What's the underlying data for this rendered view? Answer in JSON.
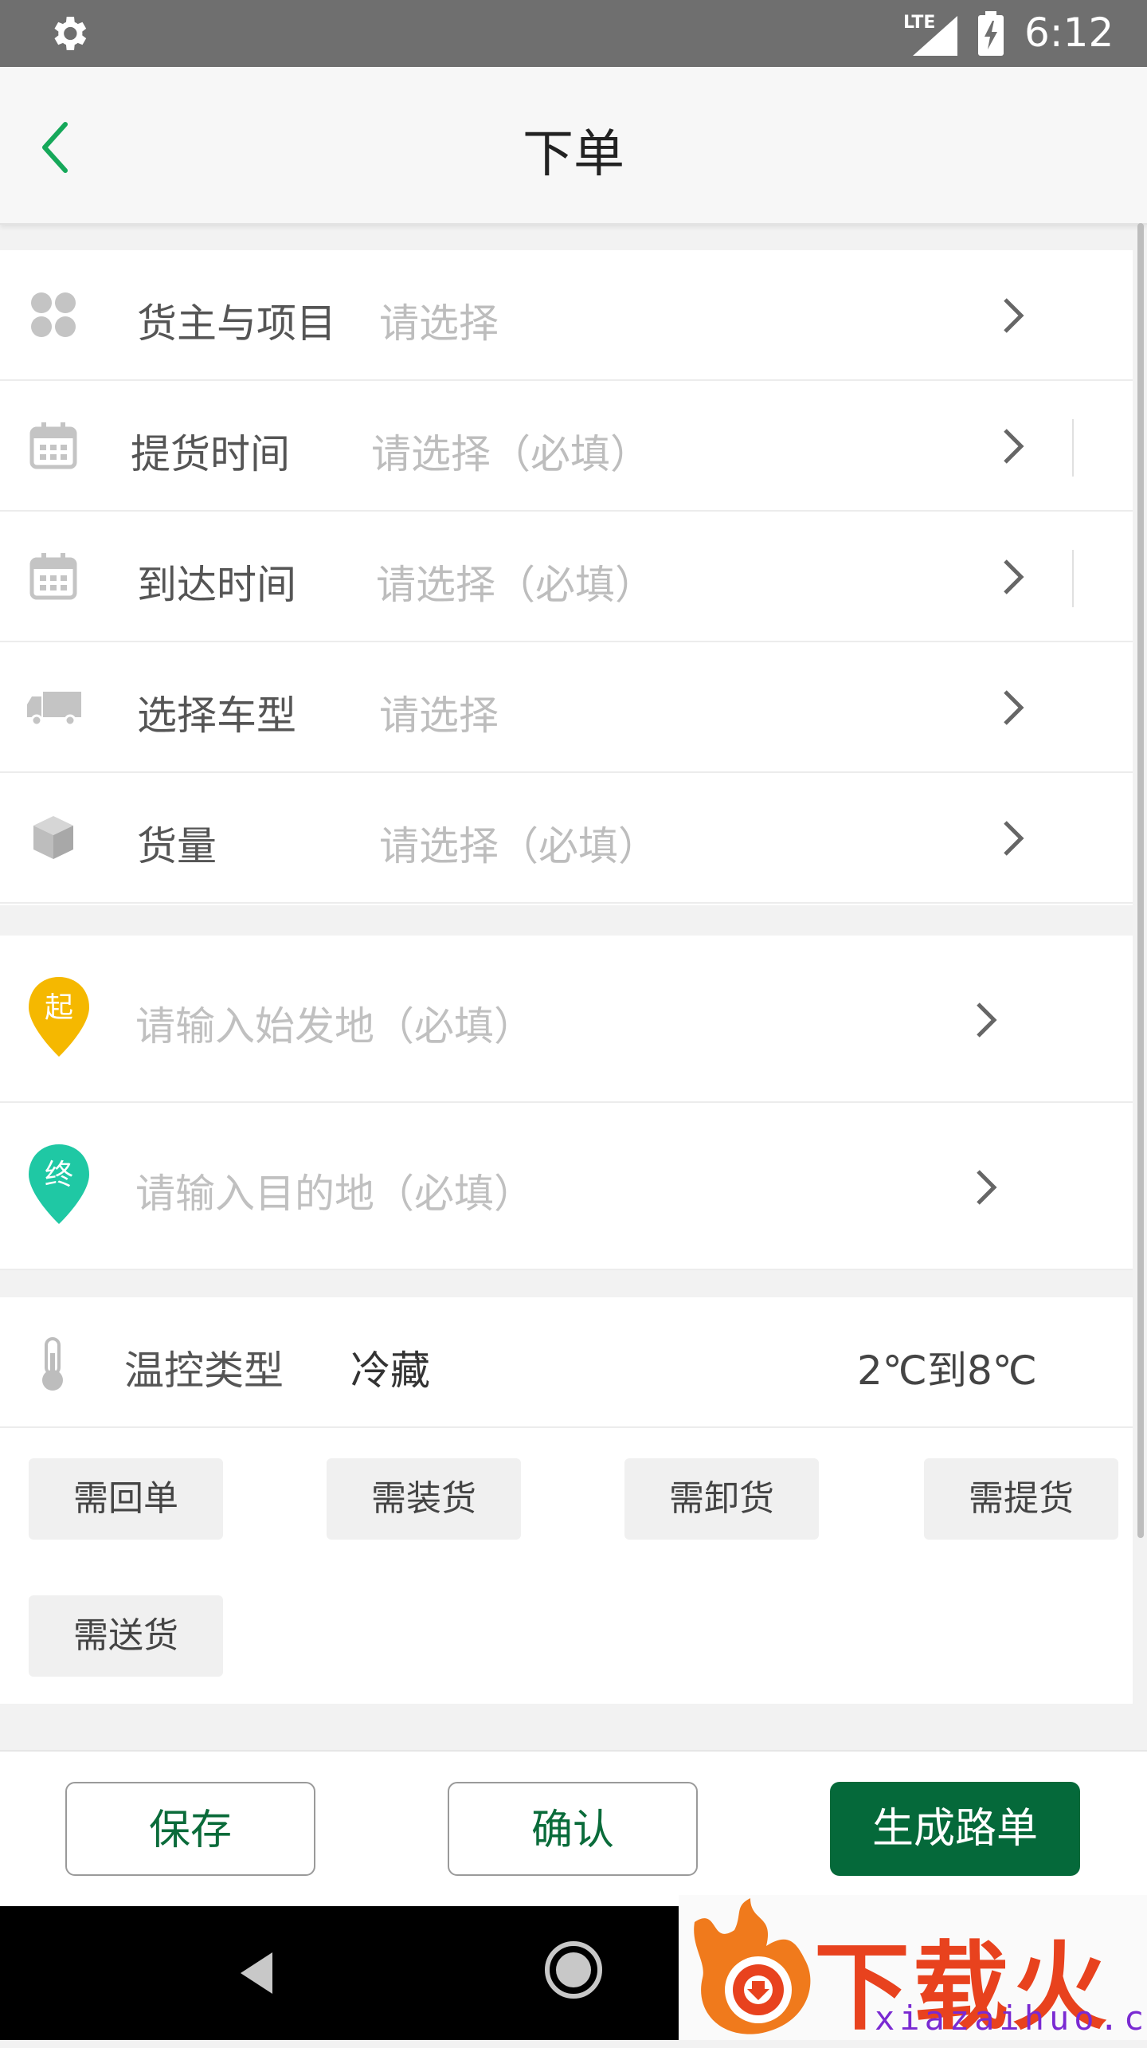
{
  "status_bar": {
    "network": "LTE",
    "time": "6:12"
  },
  "header": {
    "title": "下单"
  },
  "form_rows": [
    {
      "label": "货主与项目",
      "value": "请选择"
    },
    {
      "label": "提货时间",
      "value": "请选择（必填）"
    },
    {
      "label": "到达时间",
      "value": "请选择（必填）"
    },
    {
      "label": "选择车型",
      "value": "请选择"
    },
    {
      "label": "货量",
      "value": "请选择（必填）"
    }
  ],
  "route": {
    "origin": {
      "badge": "起",
      "placeholder": "请输入始发地（必填）",
      "color": "#f5b800"
    },
    "destination": {
      "badge": "终",
      "placeholder": "请输入目的地（必填）",
      "color": "#1fc8a4"
    }
  },
  "temperature": {
    "label": "温控类型",
    "type": "冷藏",
    "range": "2℃到8℃"
  },
  "options": [
    "需回单",
    "需装货",
    "需卸货",
    "需提货",
    "需送货"
  ],
  "actions": {
    "save": "保存",
    "confirm": "确认",
    "generate": "生成路单"
  },
  "watermark": {
    "text": "下载火",
    "site": "xiazaihuo.com"
  },
  "colors": {
    "accent": "#05693a",
    "back_arrow": "#16a85a"
  }
}
